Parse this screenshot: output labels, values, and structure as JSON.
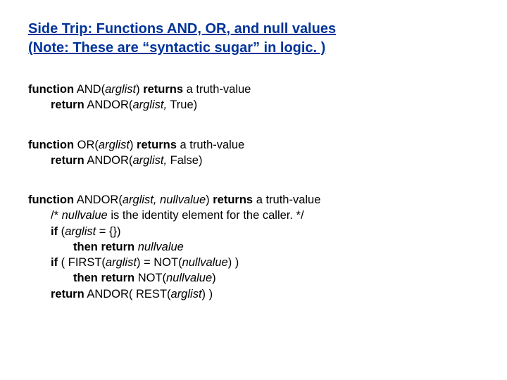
{
  "title": {
    "line1": "Side Trip:  Functions AND, OR, and null values",
    "line2": "(Note: These are “syntactic sugar” in logic. )"
  },
  "block_and": {
    "l1": {
      "kw1": "function",
      "fn": " AND(",
      "arg": "arglist",
      "close": ") ",
      "kw2": "returns",
      "tail": " a truth-value"
    },
    "l2": {
      "kw": "return",
      "tail": " ANDOR(",
      "arg": "arglist,",
      "tail2": " True)"
    }
  },
  "block_or": {
    "l1": {
      "kw1": "function",
      "fn": " OR(",
      "arg": "arglist",
      "close": ") ",
      "kw2": "returns",
      "tail": " a truth-value"
    },
    "l2": {
      "kw": "return",
      "tail": " ANDOR(",
      "arg": "arglist,",
      "tail2": " False)"
    }
  },
  "block_andor": {
    "l1": {
      "kw1": "function",
      "fn": " ANDOR(",
      "arg": "arglist, nullvalue",
      "close": ") ",
      "kw2": "returns",
      "tail": " a truth-value"
    },
    "l2": {
      "pre": "/* ",
      "it1": "nullvalue",
      "mid": " is the identity element for the caller. */"
    },
    "l3": {
      "kw": "if",
      "pre": " (",
      "arg": "arglist",
      "post": " = {})"
    },
    "l4": {
      "kw1": "then",
      "sp": " ",
      "kw2": "return",
      "sp2": " ",
      "it": "nullvalue"
    },
    "l5": {
      "kw": "if",
      "pre": " ( FIRST(",
      "arg": "arglist",
      "mid": ") = NOT(",
      "it2": "nullvalue",
      "post": ") )"
    },
    "l6": {
      "kw1": "then",
      "sp": " ",
      "kw2": "return",
      "txt": " NOT(",
      "it": "nullvalue",
      "post": ")"
    },
    "l7": {
      "kw": "return",
      "txt": " ANDOR( REST(",
      "arg": "arglist",
      "post": ") )"
    }
  }
}
